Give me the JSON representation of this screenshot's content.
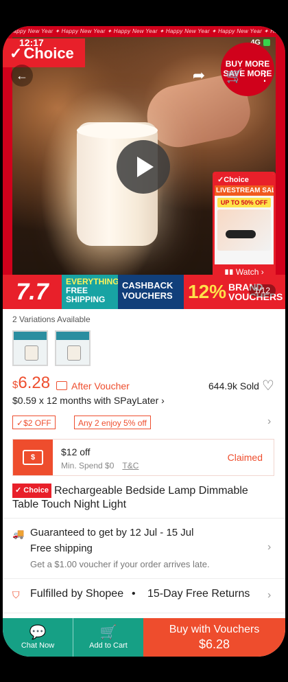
{
  "status_bar": {
    "time": "12:17",
    "icons": "4G"
  },
  "hero": {
    "choice_badge": "Choice",
    "banner_text": "✦ Happy New Year ✦ Happy New Year ✦ Happy New Year ✦ Happy New Year ✦ Happy New Year ✦ Happy New Year ✦",
    "buy_more_label": "BUY MORE SAVE MORE",
    "counter": "1/12",
    "livestream": {
      "title": "Choice",
      "subtitle": "LIVESTREAM SALE",
      "offer": "UP TO 50% OFF",
      "watch": "Watch"
    },
    "promo": {
      "sale": "7.7",
      "free_line1": "EVERYTHING",
      "free_line2": "FREE",
      "free_line3": "SHIPPING",
      "cash_line1": "CASHBACK",
      "cash_line2": "VOUCHERS",
      "brand_percent": "12%",
      "brand_line1": "BRAND",
      "brand_line2": "VOUCHERS"
    }
  },
  "product": {
    "variations": "2 Variations Available",
    "currency": "$",
    "price": "6.28",
    "after_voucher": "After Voucher",
    "sold": "644.9k Sold",
    "installment": "$0.59 x 12 months with SPayLater",
    "chips": [
      "$2 OFF",
      "Any 2 enjoy 5% off"
    ],
    "voucher": {
      "amount": "$12 off",
      "min_spend": "Min. Spend $0",
      "tc": "T&C",
      "status": "Claimed"
    },
    "choice_tag": "Choice",
    "title": "Rechargeable Bedside Lamp Dimmable Table Touch Night Light"
  },
  "shipping": {
    "guarantee": "Guaranteed to get by 12 Jul - 15 Jul",
    "free": "Free shipping",
    "late_note": "Get a $1.00 voucher if your order arrives late."
  },
  "fulfilment": {
    "fulfilled": "Fulfilled by Shopee",
    "separator": "•",
    "returns": "15-Day Free Returns"
  },
  "bottom_bar": {
    "chat": "Chat Now",
    "cart": "Add to Cart",
    "buy_label": "Buy with Vouchers",
    "buy_price": "$6.28"
  },
  "colors": {
    "accent": "#ee4d2d",
    "teal": "#16a085",
    "choice_red": "#e8202a"
  }
}
